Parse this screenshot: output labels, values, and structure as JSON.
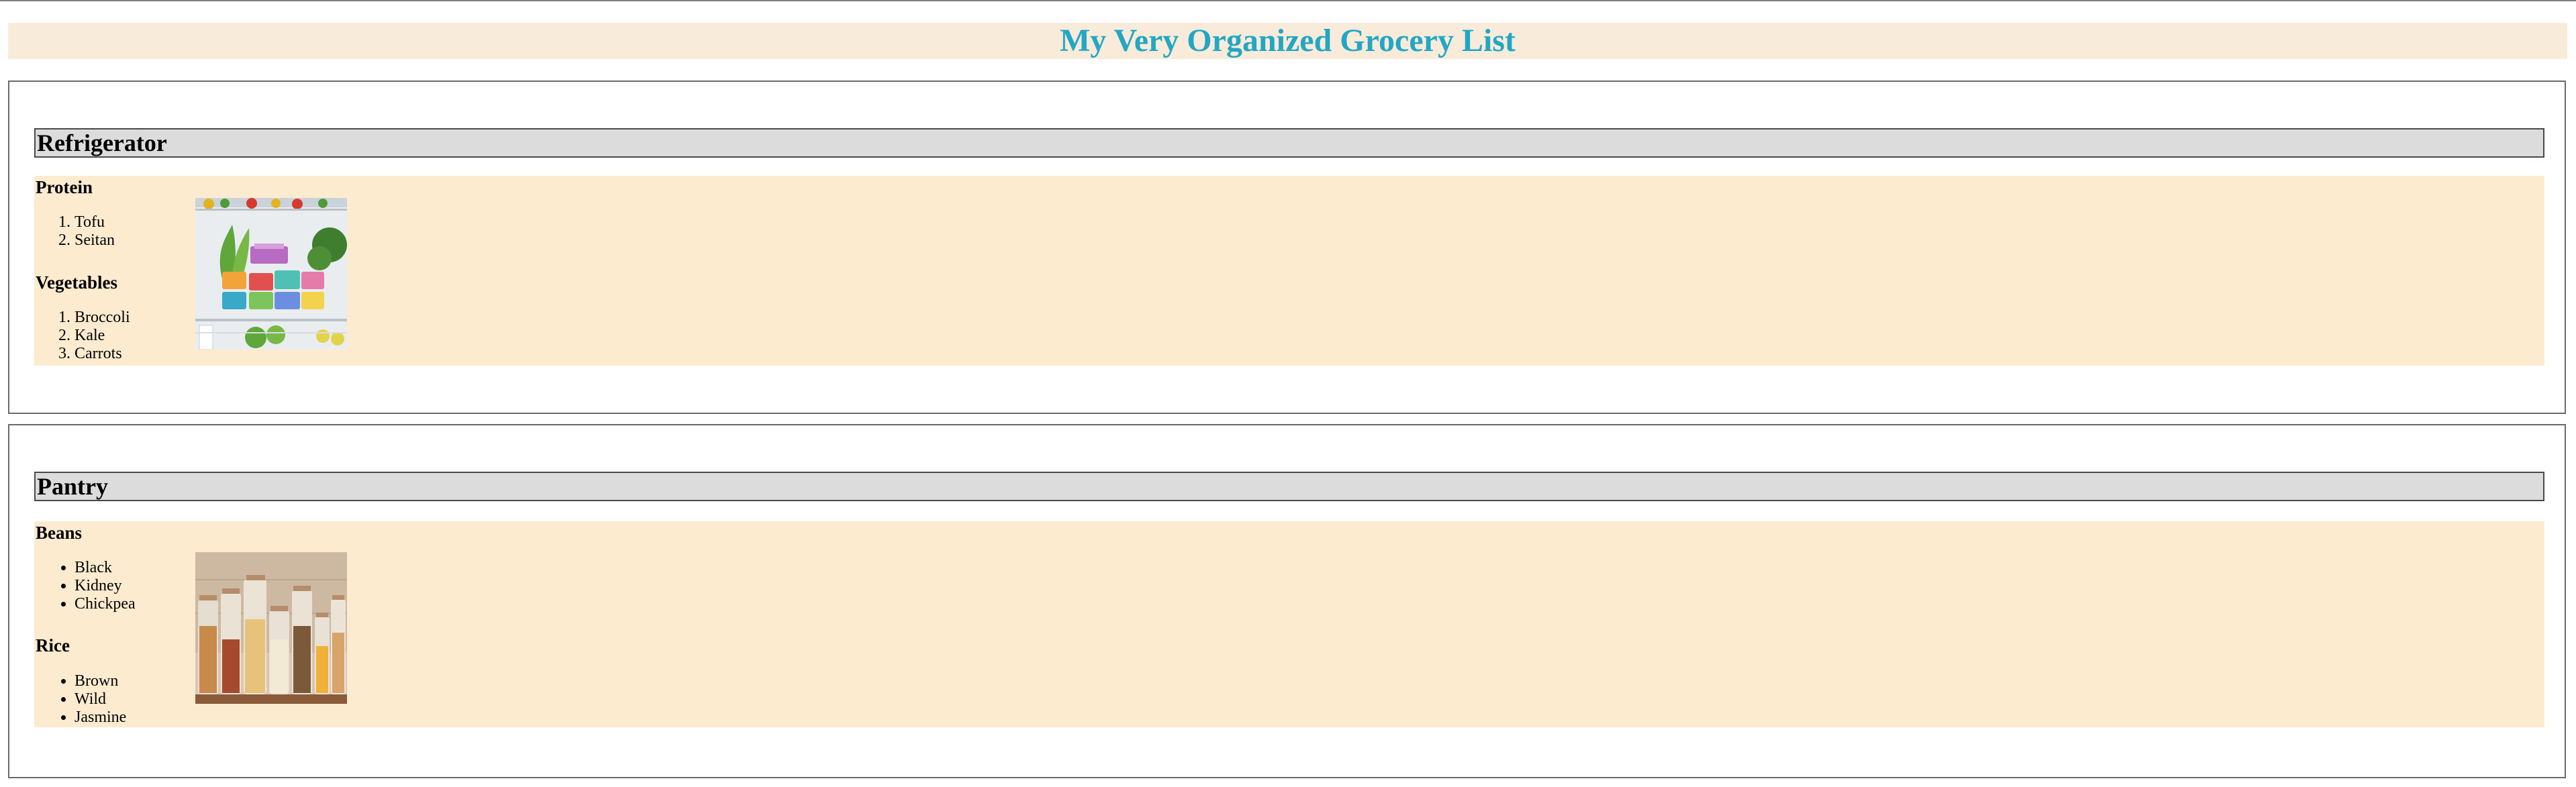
{
  "page": {
    "title": "My Very Organized Grocery List"
  },
  "sections": [
    {
      "heading": "Refrigerator",
      "groups": [
        {
          "title": "Protein",
          "list_style": "ordered",
          "items": [
            "Tofu",
            "Seitan"
          ]
        },
        {
          "title": "Vegetables",
          "list_style": "ordered",
          "items": [
            "Broccoli",
            "Kale",
            "Carrots"
          ]
        }
      ],
      "photo": "refrigerator-photo"
    },
    {
      "heading": "Pantry",
      "groups": [
        {
          "title": "Beans",
          "list_style": "unordered",
          "items": [
            "Black",
            "Kidney",
            "Chickpea"
          ]
        },
        {
          "title": "Rice",
          "list_style": "unordered",
          "items": [
            "Brown",
            "Wild",
            "Jasmine"
          ]
        }
      ],
      "photo": "pantry-photo"
    }
  ],
  "colors": {
    "title": "#22a7c4",
    "header_band": "#f9ebda",
    "content_band": "#fdebd0",
    "section_heading_bg": "#dcdcdc"
  }
}
